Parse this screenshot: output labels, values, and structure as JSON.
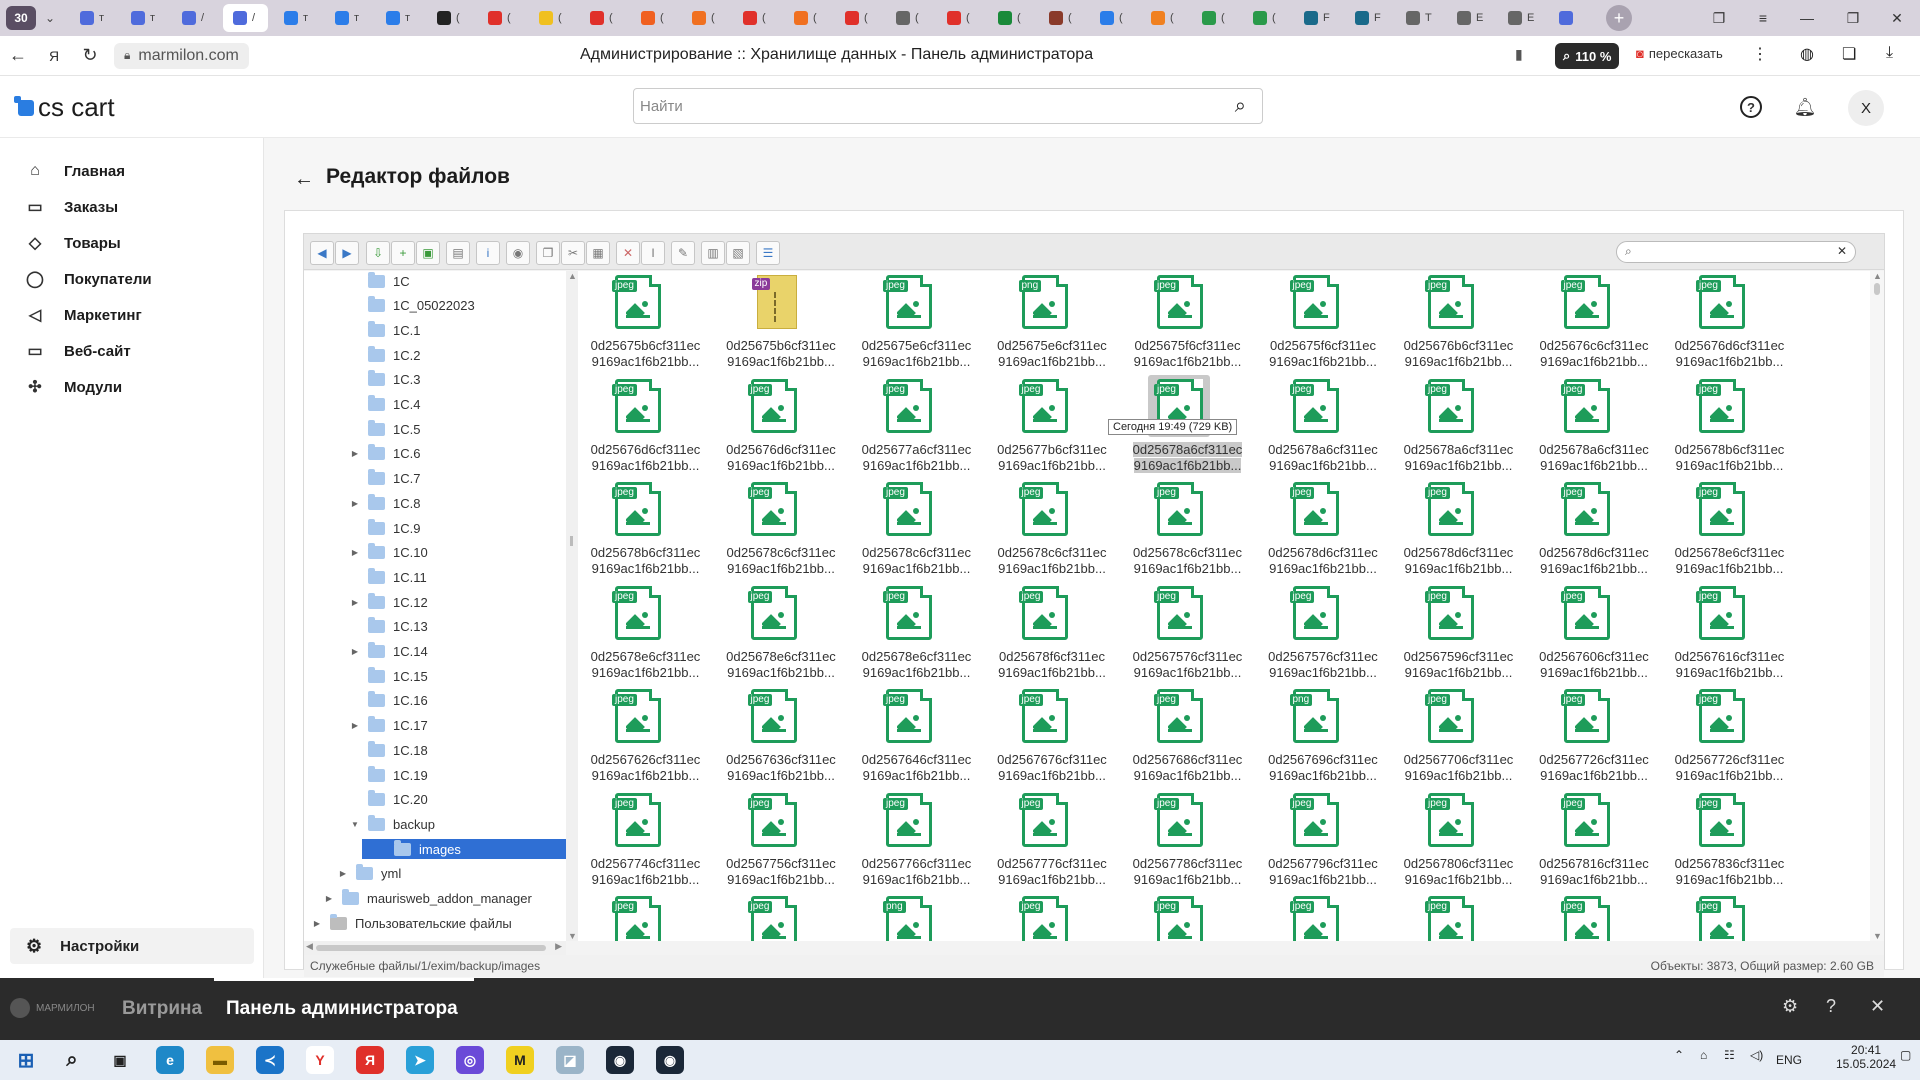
{
  "browser": {
    "tab_count": "30",
    "tabs": [
      {
        "color": "#4f6bdc",
        "title": "т"
      },
      {
        "color": "#4f6bdc",
        "title": "т"
      },
      {
        "color": "#4f6bdc",
        "title": "/"
      },
      {
        "color": "#4f6bdc",
        "title": "/",
        "active": true
      },
      {
        "color": "#2b7de9",
        "title": "т"
      },
      {
        "color": "#2b7de9",
        "title": "т"
      },
      {
        "color": "#2b7de9",
        "title": "т"
      },
      {
        "color": "#222222",
        "title": "("
      },
      {
        "color": "#e0302a",
        "title": "("
      },
      {
        "color": "#f0c020",
        "title": "("
      },
      {
        "color": "#e0302a",
        "title": "("
      },
      {
        "color": "#f06020",
        "title": "("
      },
      {
        "color": "#f07020",
        "title": "("
      },
      {
        "color": "#e0302a",
        "title": "("
      },
      {
        "color": "#f07020",
        "title": "("
      },
      {
        "color": "#e0302a",
        "title": "("
      },
      {
        "color": "#666666",
        "title": "("
      },
      {
        "color": "#e0302a",
        "title": "("
      },
      {
        "color": "#1a8a3a",
        "title": "("
      },
      {
        "color": "#8a3a2a",
        "title": "("
      },
      {
        "color": "#2b7de9",
        "title": "("
      },
      {
        "color": "#f08020",
        "title": "("
      },
      {
        "color": "#2a9a4a",
        "title": "("
      },
      {
        "color": "#2a9a4a",
        "title": "("
      },
      {
        "color": "#1a6a8a",
        "title": "F"
      },
      {
        "color": "#1a6a8a",
        "title": "F"
      },
      {
        "color": "#666666",
        "title": "Т"
      },
      {
        "color": "#666666",
        "title": "Е"
      },
      {
        "color": "#666666",
        "title": "Е"
      },
      {
        "color": "#4f6bdc",
        "title": ""
      }
    ],
    "url": "marmilon.com",
    "page_title": "Администрирование :: Хранилище данных - Панель администратора",
    "zoom": "110 %",
    "translate_label": "пересказать"
  },
  "header": {
    "logo_text": "cs cart",
    "search_placeholder": "Найти",
    "avatar_initial": "Х"
  },
  "sidebar": {
    "items": [
      {
        "label": "Главная",
        "icon": "home-icon",
        "glyph": "⌂"
      },
      {
        "label": "Заказы",
        "icon": "inbox-icon",
        "glyph": "▭"
      },
      {
        "label": "Товары",
        "icon": "tag-icon",
        "glyph": "◇"
      },
      {
        "label": "Покупатели",
        "icon": "user-icon",
        "glyph": "◯"
      },
      {
        "label": "Маркетинг",
        "icon": "megaphone-icon",
        "glyph": "◁"
      },
      {
        "label": "Веб-сайт",
        "icon": "monitor-icon",
        "glyph": "▭"
      },
      {
        "label": "Модули",
        "icon": "puzzle-icon",
        "glyph": "✣"
      }
    ],
    "settings_label": "Настройки"
  },
  "page": {
    "title": "Редактор файлов"
  },
  "tree": {
    "items": [
      {
        "label": "1C",
        "depth": 2,
        "arrow": ""
      },
      {
        "label": "1C_05022023",
        "depth": 2,
        "arrow": ""
      },
      {
        "label": "1C.1",
        "depth": 2,
        "arrow": ""
      },
      {
        "label": "1C.2",
        "depth": 2,
        "arrow": ""
      },
      {
        "label": "1C.3",
        "depth": 2,
        "arrow": ""
      },
      {
        "label": "1C.4",
        "depth": 2,
        "arrow": ""
      },
      {
        "label": "1C.5",
        "depth": 2,
        "arrow": ""
      },
      {
        "label": "1C.6",
        "depth": 2,
        "arrow": "▶"
      },
      {
        "label": "1C.7",
        "depth": 2,
        "arrow": ""
      },
      {
        "label": "1C.8",
        "depth": 2,
        "arrow": "▶"
      },
      {
        "label": "1C.9",
        "depth": 2,
        "arrow": ""
      },
      {
        "label": "1C.10",
        "depth": 2,
        "arrow": "▶"
      },
      {
        "label": "1C.11",
        "depth": 2,
        "arrow": ""
      },
      {
        "label": "1C.12",
        "depth": 2,
        "arrow": "▶"
      },
      {
        "label": "1C.13",
        "depth": 2,
        "arrow": ""
      },
      {
        "label": "1C.14",
        "depth": 2,
        "arrow": "▶"
      },
      {
        "label": "1C.15",
        "depth": 2,
        "arrow": ""
      },
      {
        "label": "1C.16",
        "depth": 2,
        "arrow": ""
      },
      {
        "label": "1C.17",
        "depth": 2,
        "arrow": "▶"
      },
      {
        "label": "1C.18",
        "depth": 2,
        "arrow": ""
      },
      {
        "label": "1C.19",
        "depth": 2,
        "arrow": ""
      },
      {
        "label": "1C.20",
        "depth": 2,
        "arrow": ""
      },
      {
        "label": "backup",
        "depth": 2,
        "arrow": "▼"
      },
      {
        "label": "images",
        "depth": 3,
        "arrow": "",
        "selected": true
      },
      {
        "label": "yml",
        "depth": 1,
        "arrow": "▶"
      },
      {
        "label": "maurisweb_addon_manager",
        "depth": 0,
        "arrow": "▶"
      },
      {
        "label": "Пользовательские файлы",
        "depth": -1,
        "arrow": "▶",
        "drive": true
      }
    ]
  },
  "files": {
    "rows": [
      [
        {
          "type": "jpeg",
          "l1": "0d25675b6cf311ec",
          "l2": "9169ac1f6b21bb..."
        },
        {
          "type": "zip",
          "l1": "0d25675b6cf311ec",
          "l2": "9169ac1f6b21bb..."
        },
        {
          "type": "jpeg",
          "l1": "0d25675e6cf311ec",
          "l2": "9169ac1f6b21bb..."
        },
        {
          "type": "png",
          "l1": "0d25675e6cf311ec",
          "l2": "9169ac1f6b21bb..."
        },
        {
          "type": "jpeg",
          "l1": "0d25675f6cf311ec",
          "l2": "9169ac1f6b21bb..."
        },
        {
          "type": "jpeg",
          "l1": "0d25675f6cf311ec",
          "l2": "9169ac1f6b21bb..."
        },
        {
          "type": "jpeg",
          "l1": "0d25676b6cf311ec",
          "l2": "9169ac1f6b21bb..."
        },
        {
          "type": "jpeg",
          "l1": "0d25676c6cf311ec",
          "l2": "9169ac1f6b21bb..."
        },
        {
          "type": "jpeg",
          "l1": "0d25676d6cf311ec",
          "l2": "9169ac1f6b21bb..."
        }
      ],
      [
        {
          "type": "jpeg",
          "l1": "0d25676d6cf311ec",
          "l2": "9169ac1f6b21bb..."
        },
        {
          "type": "jpeg",
          "l1": "0d25676d6cf311ec",
          "l2": "9169ac1f6b21bb..."
        },
        {
          "type": "jpeg",
          "l1": "0d25677a6cf311ec",
          "l2": "9169ac1f6b21bb..."
        },
        {
          "type": "jpeg",
          "l1": "0d25677b6cf311ec",
          "l2": "9169ac1f6b21bb..."
        },
        {
          "type": "jpeg",
          "l1": "0d25678a6cf311ec",
          "l2": "9169ac1f6b21bb...",
          "selected": true
        },
        {
          "type": "jpeg",
          "l1": "0d25678a6cf311ec",
          "l2": "9169ac1f6b21bb..."
        },
        {
          "type": "jpeg",
          "l1": "0d25678a6cf311ec",
          "l2": "9169ac1f6b21bb..."
        },
        {
          "type": "jpeg",
          "l1": "0d25678a6cf311ec",
          "l2": "9169ac1f6b21bb..."
        },
        {
          "type": "jpeg",
          "l1": "0d25678b6cf311ec",
          "l2": "9169ac1f6b21bb..."
        }
      ],
      [
        {
          "type": "jpeg",
          "l1": "0d25678b6cf311ec",
          "l2": "9169ac1f6b21bb..."
        },
        {
          "type": "jpeg",
          "l1": "0d25678c6cf311ec",
          "l2": "9169ac1f6b21bb..."
        },
        {
          "type": "jpeg",
          "l1": "0d25678c6cf311ec",
          "l2": "9169ac1f6b21bb..."
        },
        {
          "type": "jpeg",
          "l1": "0d25678c6cf311ec",
          "l2": "9169ac1f6b21bb..."
        },
        {
          "type": "jpeg",
          "l1": "0d25678c6cf311ec",
          "l2": "9169ac1f6b21bb..."
        },
        {
          "type": "jpeg",
          "l1": "0d25678d6cf311ec",
          "l2": "9169ac1f6b21bb..."
        },
        {
          "type": "jpeg",
          "l1": "0d25678d6cf311ec",
          "l2": "9169ac1f6b21bb..."
        },
        {
          "type": "jpeg",
          "l1": "0d25678d6cf311ec",
          "l2": "9169ac1f6b21bb..."
        },
        {
          "type": "jpeg",
          "l1": "0d25678e6cf311ec",
          "l2": "9169ac1f6b21bb..."
        }
      ],
      [
        {
          "type": "jpeg",
          "l1": "0d25678e6cf311ec",
          "l2": "9169ac1f6b21bb..."
        },
        {
          "type": "jpeg",
          "l1": "0d25678e6cf311ec",
          "l2": "9169ac1f6b21bb..."
        },
        {
          "type": "jpeg",
          "l1": "0d25678e6cf311ec",
          "l2": "9169ac1f6b21bb..."
        },
        {
          "type": "jpeg",
          "l1": "0d25678f6cf311ec",
          "l2": "9169ac1f6b21bb..."
        },
        {
          "type": "jpeg",
          "l1": "0d2567576cf311ec",
          "l2": "9169ac1f6b21bb..."
        },
        {
          "type": "jpeg",
          "l1": "0d2567576cf311ec",
          "l2": "9169ac1f6b21bb..."
        },
        {
          "type": "jpeg",
          "l1": "0d2567596cf311ec",
          "l2": "9169ac1f6b21bb..."
        },
        {
          "type": "jpeg",
          "l1": "0d2567606cf311ec",
          "l2": "9169ac1f6b21bb..."
        },
        {
          "type": "jpeg",
          "l1": "0d2567616cf311ec",
          "l2": "9169ac1f6b21bb..."
        }
      ],
      [
        {
          "type": "jpeg",
          "l1": "0d2567626cf311ec",
          "l2": "9169ac1f6b21bb..."
        },
        {
          "type": "jpeg",
          "l1": "0d2567636cf311ec",
          "l2": "9169ac1f6b21bb..."
        },
        {
          "type": "jpeg",
          "l1": "0d2567646cf311ec",
          "l2": "9169ac1f6b21bb..."
        },
        {
          "type": "jpeg",
          "l1": "0d2567676cf311ec",
          "l2": "9169ac1f6b21bb..."
        },
        {
          "type": "jpeg",
          "l1": "0d2567686cf311ec",
          "l2": "9169ac1f6b21bb..."
        },
        {
          "type": "png",
          "l1": "0d2567696cf311ec",
          "l2": "9169ac1f6b21bb..."
        },
        {
          "type": "jpeg",
          "l1": "0d2567706cf311ec",
          "l2": "9169ac1f6b21bb..."
        },
        {
          "type": "jpeg",
          "l1": "0d2567726cf311ec",
          "l2": "9169ac1f6b21bb..."
        },
        {
          "type": "jpeg",
          "l1": "0d2567726cf311ec",
          "l2": "9169ac1f6b21bb..."
        }
      ],
      [
        {
          "type": "jpeg",
          "l1": "0d2567746cf311ec",
          "l2": "9169ac1f6b21bb..."
        },
        {
          "type": "jpeg",
          "l1": "0d2567756cf311ec",
          "l2": "9169ac1f6b21bb..."
        },
        {
          "type": "jpeg",
          "l1": "0d2567766cf311ec",
          "l2": "9169ac1f6b21bb..."
        },
        {
          "type": "jpeg",
          "l1": "0d2567776cf311ec",
          "l2": "9169ac1f6b21bb..."
        },
        {
          "type": "jpeg",
          "l1": "0d2567786cf311ec",
          "l2": "9169ac1f6b21bb..."
        },
        {
          "type": "jpeg",
          "l1": "0d2567796cf311ec",
          "l2": "9169ac1f6b21bb..."
        },
        {
          "type": "jpeg",
          "l1": "0d2567806cf311ec",
          "l2": "9169ac1f6b21bb..."
        },
        {
          "type": "jpeg",
          "l1": "0d2567816cf311ec",
          "l2": "9169ac1f6b21bb..."
        },
        {
          "type": "jpeg",
          "l1": "0d2567836cf311ec",
          "l2": "9169ac1f6b21bb..."
        }
      ],
      [
        {
          "type": "jpeg",
          "l1": "",
          "l2": ""
        },
        {
          "type": "jpeg",
          "l1": "",
          "l2": ""
        },
        {
          "type": "png",
          "l1": "",
          "l2": ""
        },
        {
          "type": "jpeg",
          "l1": "",
          "l2": ""
        },
        {
          "type": "jpeg",
          "l1": "",
          "l2": ""
        },
        {
          "type": "jpeg",
          "l1": "",
          "l2": ""
        },
        {
          "type": "jpeg",
          "l1": "",
          "l2": ""
        },
        {
          "type": "jpeg",
          "l1": "",
          "l2": ""
        },
        {
          "type": "jpeg",
          "l1": "",
          "l2": ""
        }
      ]
    ],
    "tooltip": "Сегодня 19:49 (729 KB)"
  },
  "statusbar": {
    "path": "Служебные файлы/1/exim/backup/images",
    "summary": "Объекты: 3873, Общий размер: 2.60 GB"
  },
  "adminbar": {
    "logo_text": "МАРМИЛОН",
    "storefront": "Витрина",
    "admin_panel": "Панель администратора"
  },
  "taskbar": {
    "lang": "ENG",
    "time": "20:41",
    "date": "15.05.2024"
  },
  "colors": {
    "accent": "#2f6fd4",
    "file_green": "#1e9c5a",
    "admin_bar": "#2b2b2b"
  }
}
